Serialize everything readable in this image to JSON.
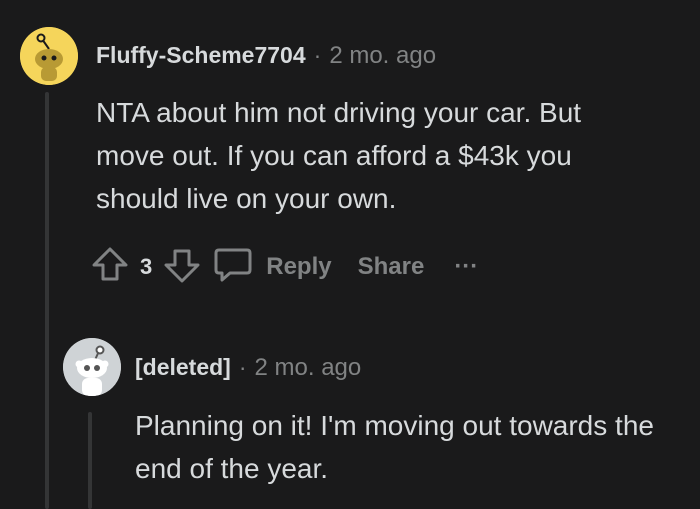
{
  "comments": [
    {
      "username": "Fluffy-Scheme7704",
      "separator": "·",
      "time": "2 mo. ago",
      "body": "NTA about him not driving your car. But move out. If you can afford a $43k you should live on your own.",
      "score": "3",
      "avatar_color": "#f5d55b"
    },
    {
      "username": "[deleted]",
      "separator": "·",
      "time": "2 mo. ago",
      "body": "Planning on it! I'm moving out towards the end of the year.",
      "avatar_color": "#cfd3d6"
    }
  ],
  "actions": {
    "reply_label": "Reply",
    "share_label": "Share",
    "more_label": "···",
    "upvote_icon": "upvote-arrow-icon",
    "downvote_icon": "downvote-arrow-icon",
    "reply_icon": "speech-bubble-icon"
  },
  "colors": {
    "background": "#1a1a1b",
    "text": "#d7dadc",
    "muted": "#818384",
    "thread_line": "#343536"
  }
}
